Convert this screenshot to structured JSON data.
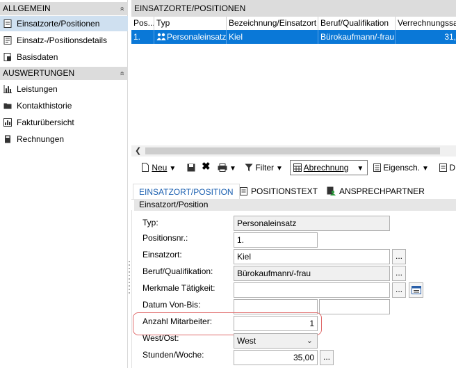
{
  "sidebar": {
    "sections": [
      {
        "title": "ALLGEMEIN",
        "items": [
          {
            "label": "Einsatzorte/Positionen",
            "icon": "list-doc-icon",
            "active": true
          },
          {
            "label": "Einsatz-/Positionsdetails",
            "icon": "details-doc-icon"
          },
          {
            "label": "Basisdaten",
            "icon": "data-doc-icon"
          }
        ]
      },
      {
        "title": "AUSWERTUNGEN",
        "items": [
          {
            "label": "Leistungen",
            "icon": "bar-chart-icon"
          },
          {
            "label": "Kontakthistorie",
            "icon": "folder-icon"
          },
          {
            "label": "Fakturübersicht",
            "icon": "invoice-chart-icon"
          },
          {
            "label": "Rechnungen",
            "icon": "invoice-icon"
          }
        ]
      }
    ],
    "collapse_glyph": "«"
  },
  "grid": {
    "title": "EINSATZORTE/POSITIONEN",
    "columns": [
      "Pos...",
      "Typ",
      "Bezeichnung/Einsatzort",
      "Beruf/Qualifikation",
      "Verrechnungssa"
    ],
    "rows": [
      {
        "pos": "1.",
        "typ": "Personaleinsatz",
        "bezeichnung": "Kiel",
        "beruf": "Bürokaufmann/-frau",
        "verrechnung": "31,"
      }
    ]
  },
  "toolbar": {
    "new_label": "Neu",
    "filter_label": "Filter",
    "abrechnung_label": "Abrechnung",
    "eigensch_label": "Eigensch.",
    "more_label": "D"
  },
  "tabs": [
    {
      "label": "EINSATZORT/POSITION",
      "active": true
    },
    {
      "label": "POSITIONSTEXT"
    },
    {
      "label": "ANSPRECHPARTNER"
    }
  ],
  "form": {
    "section_title": "Einsatzort/Position",
    "typ_label": "Typ:",
    "typ_value": "Personaleinsatz",
    "posnr_label": "Positionsnr.:",
    "posnr_value": "1.",
    "einsatzort_label": "Einsatzort:",
    "einsatzort_value": "Kiel",
    "beruf_label": "Beruf/Qualifikation:",
    "beruf_value": "Bürokaufmann/-frau",
    "merkmale_label": "Merkmale Tätigkeit:",
    "merkmale_value": "",
    "datum_label": "Datum Von-Bis:",
    "datum_von": "",
    "datum_bis": "",
    "anzahl_label": "Anzahl Mitarbeiter:",
    "anzahl_value": "1",
    "westost_label": "West/Ost:",
    "westost_value": "West",
    "stunden_label": "Stunden/Woche:",
    "stunden_value": "35,00",
    "dots": "..."
  },
  "colors": {
    "selection": "#0a78d7",
    "highlight": "#e06b6b",
    "active_tab": "#1a5fb0"
  }
}
